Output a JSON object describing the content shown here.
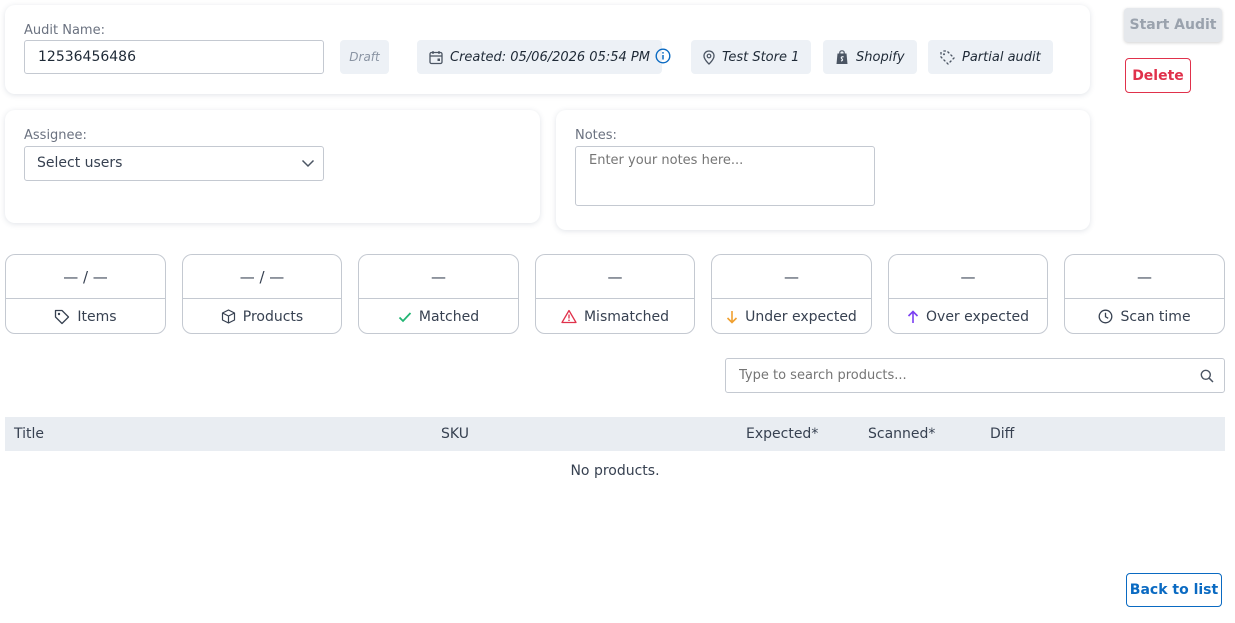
{
  "audit": {
    "name_label": "Audit Name:",
    "name_value": "12536456486",
    "status_badge": "Draft",
    "created": "Created: 05/06/2026 05:54 PM",
    "store": "Test Store 1",
    "platform": "Shopify",
    "audit_type": "Partial audit"
  },
  "actions": {
    "start_audit": "Start Audit",
    "delete": "Delete",
    "back_to_list": "Back to list"
  },
  "assignee": {
    "label": "Assignee:",
    "placeholder": "Select users"
  },
  "notes": {
    "label": "Notes:",
    "placeholder": "Enter your notes here..."
  },
  "stats": [
    {
      "value": "— / —",
      "label": "Items",
      "icon": "tag-icon"
    },
    {
      "value": "— / —",
      "label": "Products",
      "icon": "box-icon"
    },
    {
      "value": "—",
      "label": "Matched",
      "icon": "check-icon"
    },
    {
      "value": "—",
      "label": "Mismatched",
      "icon": "warning-icon"
    },
    {
      "value": "—",
      "label": "Under expected",
      "icon": "arrow-down-icon"
    },
    {
      "value": "—",
      "label": "Over expected",
      "icon": "arrow-up-icon"
    },
    {
      "value": "—",
      "label": "Scan time",
      "icon": "clock-icon"
    }
  ],
  "search": {
    "placeholder": "Type to search products..."
  },
  "table": {
    "columns": [
      "Title",
      "SKU",
      "Expected*",
      "Scanned*",
      "Diff"
    ],
    "empty_message": "No products."
  },
  "colors": {
    "matched": "#22b573",
    "mismatched": "#e0314b",
    "under_expected": "#f0a030",
    "over_expected": "#7b3ff2",
    "link_blue": "#0a6ac2",
    "danger": "#e0314b"
  }
}
